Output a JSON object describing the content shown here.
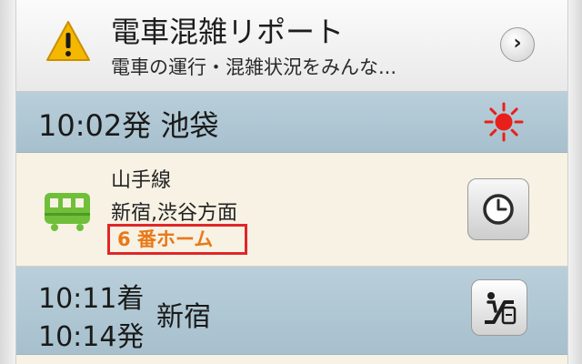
{
  "report": {
    "title": "電車混雑リポート",
    "subtitle": "電車の運行・混雑状況をみんな...",
    "chevron": "›"
  },
  "departure": {
    "text": "10:02発 池袋"
  },
  "line": {
    "name": "山手線",
    "direction": "新宿,渋谷方面",
    "platform": "6 番ホーム"
  },
  "arrival": {
    "arrive_time": "10:11着",
    "depart_time": "10:14発",
    "station": "新宿"
  },
  "colors": {
    "warning": "#f5b800",
    "sun": "#e8201c",
    "train": "#6fbf3a",
    "platform_text": "#e87818",
    "highlight_border": "#e0262a",
    "header_bg": "#b2c9d5"
  },
  "icons": {
    "warning": "warning-triangle-icon",
    "sun": "sun-icon",
    "train": "train-icon",
    "clock": "clock-icon",
    "transfer": "escalator-transfer-icon"
  }
}
